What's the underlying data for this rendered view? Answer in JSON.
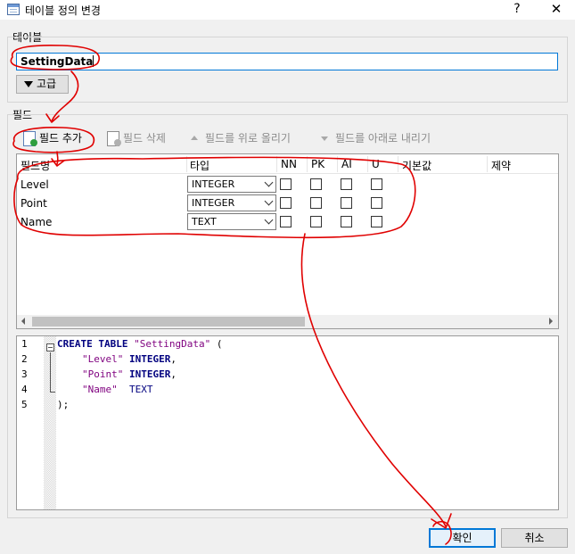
{
  "window": {
    "title": "테이블 정의 변경",
    "help": "?",
    "close": "✕"
  },
  "table_group": {
    "label": "테이블",
    "name_value": "SettingData",
    "advanced_label": "고급"
  },
  "fields_group": {
    "label": "필드",
    "toolbar": {
      "add": "필드 추가",
      "delete": "필드 삭제",
      "move_up": "필드를 위로 올리기",
      "move_down": "필드를 아래로 내리기"
    },
    "columns": [
      "필드명",
      "타입",
      "NN",
      "PK",
      "AI",
      "U",
      "기본값",
      "제약"
    ],
    "rows": [
      {
        "name": "Level",
        "type": "INTEGER",
        "nn": false,
        "pk": false,
        "ai": false,
        "u": false
      },
      {
        "name": "Point",
        "type": "INTEGER",
        "nn": false,
        "pk": false,
        "ai": false,
        "u": false
      },
      {
        "name": "Name",
        "type": "TEXT",
        "nn": false,
        "pk": false,
        "ai": false,
        "u": false
      }
    ]
  },
  "sql": {
    "line_numbers": [
      "1",
      "2",
      "3",
      "4",
      "5"
    ],
    "line1_kw": "CREATE TABLE",
    "line1_str": "\"SettingData\"",
    "line1_tail": " (",
    "line2_str": "\"Level\"",
    "line2_kw": "INTEGER",
    "line2_tail": ",",
    "line3_str": "\"Point\"",
    "line3_kw": "INTEGER",
    "line3_tail": ",",
    "line4_str": "\"Name\"",
    "line4_kw": "TEXT",
    "line5": ");"
  },
  "buttons": {
    "ok": "확인",
    "cancel": "취소"
  },
  "colors": {
    "accent": "#0078d7",
    "annotation": "#e00000",
    "keyword": "#00007f",
    "string": "#7f007f"
  },
  "icons": [
    "table-icon",
    "help-icon",
    "close-icon",
    "triangle-down-icon",
    "add-field-icon",
    "delete-field-icon",
    "arrow-up-icon",
    "arrow-down-icon",
    "chevron-down-icon"
  ]
}
